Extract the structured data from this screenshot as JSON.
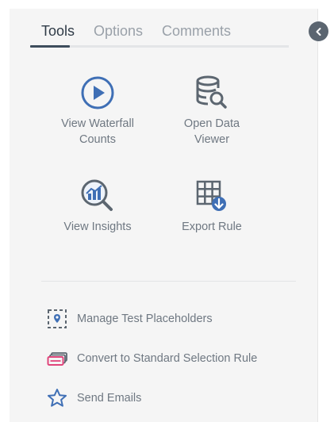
{
  "tabs": [
    {
      "label": "Tools",
      "active": true
    },
    {
      "label": "Options",
      "active": false
    },
    {
      "label": "Comments",
      "active": false
    }
  ],
  "tools": [
    {
      "label_line1": "View Waterfall",
      "label_line2": "Counts",
      "icon": "play-circle-icon"
    },
    {
      "label_line1": "Open Data",
      "label_line2": "Viewer",
      "icon": "database-search-icon"
    },
    {
      "label_line1": "View Insights",
      "label_line2": "",
      "icon": "insights-magnifier-icon"
    },
    {
      "label_line1": "Export Rule",
      "label_line2": "",
      "icon": "grid-download-icon"
    }
  ],
  "actions": [
    {
      "label": "Manage Test Placeholders",
      "icon": "placeholder-pin-icon"
    },
    {
      "label": "Convert to Standard Selection Rule",
      "icon": "cards-convert-icon"
    },
    {
      "label": "Send Emails",
      "icon": "star-icon"
    }
  ],
  "colors": {
    "accent_blue": "#3f6fb5",
    "icon_gray": "#5c6670",
    "text_gray": "#6f7882",
    "active_tab": "#2f3b47",
    "pink": "#e0457b"
  }
}
